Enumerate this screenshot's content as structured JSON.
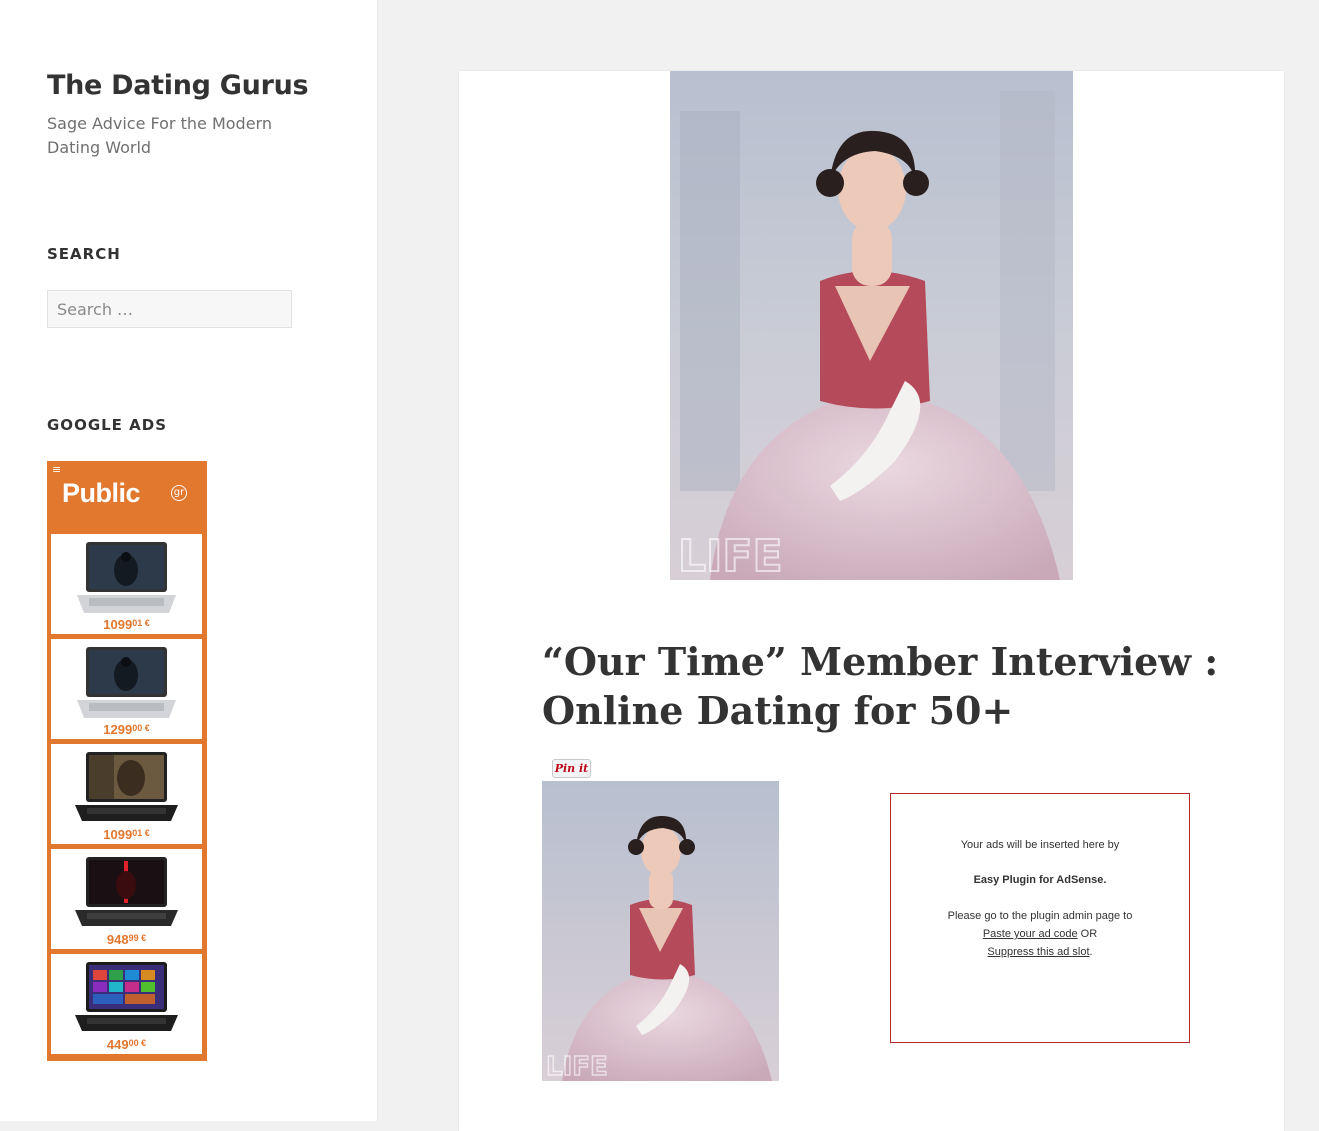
{
  "site": {
    "title": "The Dating Gurus",
    "description": "Sage Advice For the Modern Dating World"
  },
  "widgets": {
    "search": {
      "title": "SEARCH",
      "placeholder": "Search …"
    },
    "ads": {
      "title": "GOOGLE ADS",
      "menu_glyph": "≡",
      "brand": "Public",
      "brand_suffix": "gr",
      "brand_color": "#e2772e",
      "items": [
        {
          "price_main": "1099",
          "price_cents": "01 €",
          "screen": "dark-hero"
        },
        {
          "price_main": "1299",
          "price_cents": "00 €",
          "screen": "dark-hero"
        },
        {
          "price_main": "1099",
          "price_cents": "01 €",
          "screen": "warrior"
        },
        {
          "price_main": "948",
          "price_cents": "99 €",
          "screen": "red-saber"
        },
        {
          "price_main": "449",
          "price_cents": "00 €",
          "screen": "windows-tiles"
        }
      ]
    }
  },
  "post": {
    "title": "“Our Time” Member Interview : Online Dating for 50+",
    "pinit_label": "Pin it",
    "image_watermark": "LIFE"
  },
  "adsense": {
    "line1": "Your ads will be inserted here by",
    "line2": "Easy Plugin for AdSense.",
    "line3": "Please go to the plugin admin page to",
    "link1": "Paste your ad code",
    "or": " OR",
    "link2": "Suppress this ad slot",
    "period": ".",
    "border_color": "#b8262a"
  }
}
